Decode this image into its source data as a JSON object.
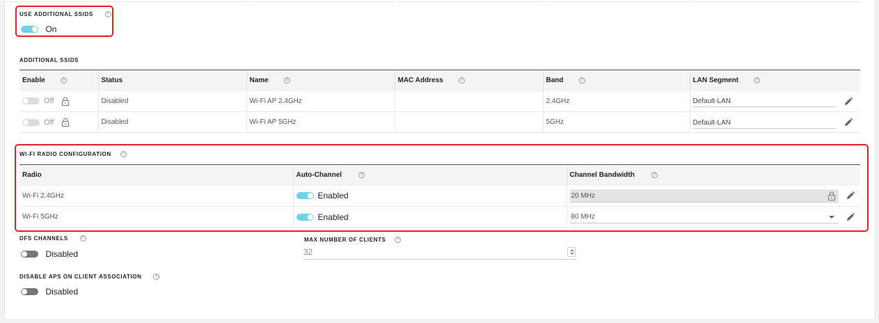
{
  "use_additional_ssids": {
    "label": "USE ADDITIONAL SSIDS",
    "help": "?",
    "state_label": "On"
  },
  "additional_ssids": {
    "section_label": "ADDITIONAL SSIDS",
    "columns": {
      "enable": "Enable",
      "status": "Status",
      "name": "Name",
      "mac": "MAC Address",
      "band": "Band",
      "lan_segment": "LAN Segment"
    },
    "rows": [
      {
        "enable_label": "Off",
        "status": "Disabled",
        "name": "Wi-Fi AP 2.4GHz",
        "mac": "",
        "band": "2.4GHz",
        "lan_segment": "Default-LAN"
      },
      {
        "enable_label": "Off",
        "status": "Disabled",
        "name": "Wi-Fi AP 5GHz",
        "mac": "",
        "band": "5GHz",
        "lan_segment": "Default-LAN"
      }
    ]
  },
  "wifi_radio": {
    "section_label": "WI-FI RADIO CONFIGURATION",
    "columns": {
      "radio": "Radio",
      "auto_channel": "Auto-Channel",
      "bandwidth": "Channel Bandwidth"
    },
    "rows": [
      {
        "radio": "Wi-Fi 2.4GHz",
        "auto_channel": "Enabled",
        "bandwidth": "20 MHz",
        "locked": true
      },
      {
        "radio": "Wi-Fi 5GHz",
        "auto_channel": "Enabled",
        "bandwidth": "80 MHz",
        "locked": false
      }
    ]
  },
  "dfs_channels": {
    "label": "DFS CHANNELS",
    "state_label": "Disabled"
  },
  "max_clients": {
    "label": "MAX NUMBER OF CLIENTS",
    "value": "32"
  },
  "disable_aps": {
    "label": "DISABLE APS ON CLIENT ASSOCIATION",
    "state_label": "Disabled"
  },
  "colors": {
    "accent": "#6fd3e3",
    "highlight": "#e52222"
  }
}
